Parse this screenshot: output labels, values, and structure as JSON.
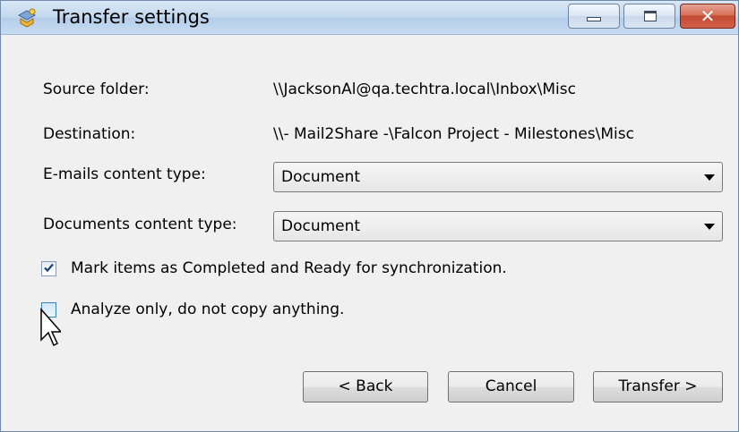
{
  "window": {
    "title": "Transfer settings",
    "controls": {
      "minimize": "minimize",
      "maximize": "maximize",
      "close": "✕"
    }
  },
  "form": {
    "source_label": "Source folder:",
    "source_value": "\\\\JacksonAl@qa.techtra.local\\Inbox\\Misc",
    "destination_label": "Destination:",
    "destination_value": "\\\\- Mail2Share -\\Falcon Project - Milestones\\Misc",
    "emails_content_type_label": "E-mails content type:",
    "emails_content_type_value": "Document",
    "documents_content_type_label": "Documents content type:",
    "documents_content_type_value": "Document",
    "mark_completed_label": "Mark items as Completed and Ready for synchronization.",
    "mark_completed_checked": true,
    "analyze_only_label": "Analyze only, do not copy anything.",
    "analyze_only_checked": false
  },
  "buttons": {
    "back": "< Back",
    "cancel": "Cancel",
    "transfer": "Transfer >"
  },
  "icons": {
    "app": "transfer-app-icon",
    "checkmark": "checkmark-icon",
    "cursor": "mouse-cursor-icon",
    "dropdown": "chevron-down-icon"
  },
  "colors": {
    "titlebar": "#c3d8ee",
    "close_button": "#c24a2f",
    "window_background": "#f0f0f0",
    "check_accent": "#3c7fb1"
  }
}
